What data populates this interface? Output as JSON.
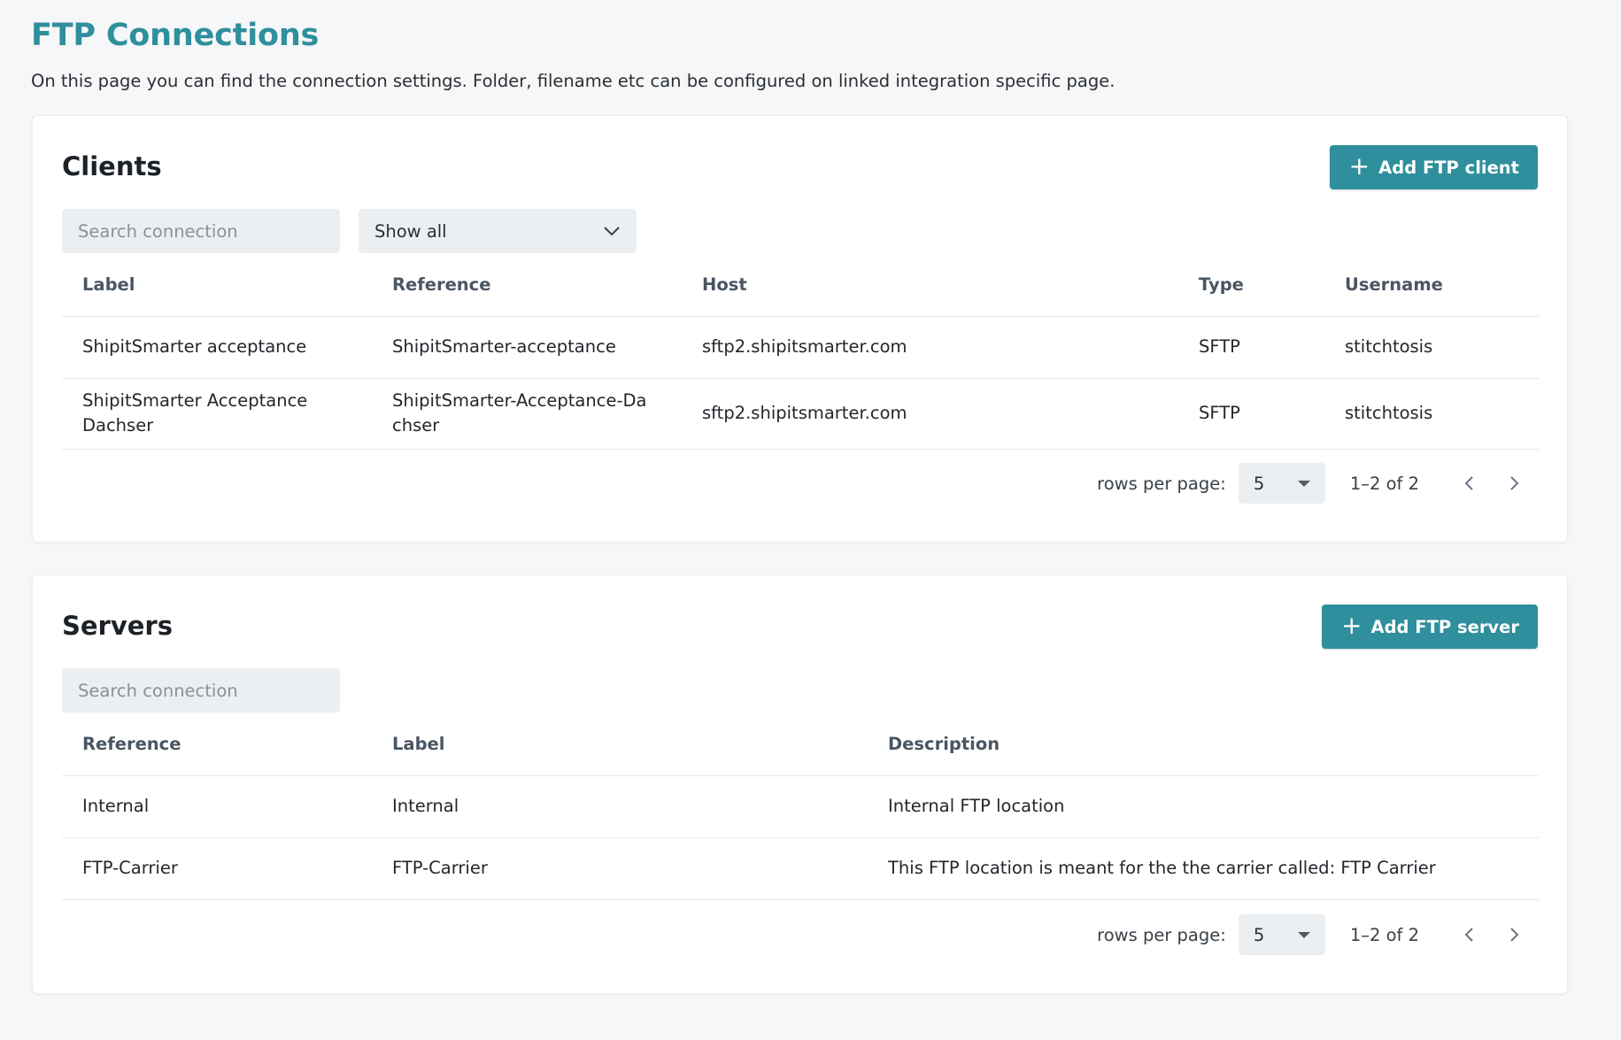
{
  "page": {
    "title": "FTP Connections",
    "description": "On this page you can find the connection settings. Folder, filename etc can be configured on linked integration specific page."
  },
  "colors": {
    "accent": "#2f8f9c",
    "input_bg": "#eceff1"
  },
  "clients": {
    "title": "Clients",
    "add_label": "Add FTP client",
    "search_placeholder": "Search connection",
    "filter_value": "Show all",
    "columns": [
      "Label",
      "Reference",
      "Host",
      "Type",
      "Username"
    ],
    "rows": [
      {
        "label": "ShipitSmarter acceptance",
        "reference": "ShipitSmarter-acceptance",
        "host": "sftp2.shipitsmarter.com",
        "type": "SFTP",
        "username": "stitchtosis"
      },
      {
        "label": "ShipitSmarter Acceptance Dachser",
        "reference": "ShipitSmarter-Acceptance-Dachser",
        "host": "sftp2.shipitsmarter.com",
        "type": "SFTP",
        "username": "stitchtosis"
      }
    ],
    "pagination": {
      "rows_label": "rows per page:",
      "rows_value": "5",
      "range": "1–2 of 2"
    }
  },
  "servers": {
    "title": "Servers",
    "add_label": "Add FTP server",
    "search_placeholder": "Search connection",
    "columns": [
      "Reference",
      "Label",
      "Description"
    ],
    "rows": [
      {
        "reference": "Internal",
        "label": "Internal",
        "description": "Internal FTP location"
      },
      {
        "reference": "FTP-Carrier",
        "label": "FTP-Carrier",
        "description": "This FTP location is meant for the the carrier called: FTP Carrier"
      }
    ],
    "pagination": {
      "rows_label": "rows per page:",
      "rows_value": "5",
      "range": "1–2 of 2"
    }
  },
  "icons": [
    "plus-icon",
    "chevron-down-icon",
    "caret-down-icon",
    "chevron-left-icon",
    "chevron-right-icon"
  ]
}
